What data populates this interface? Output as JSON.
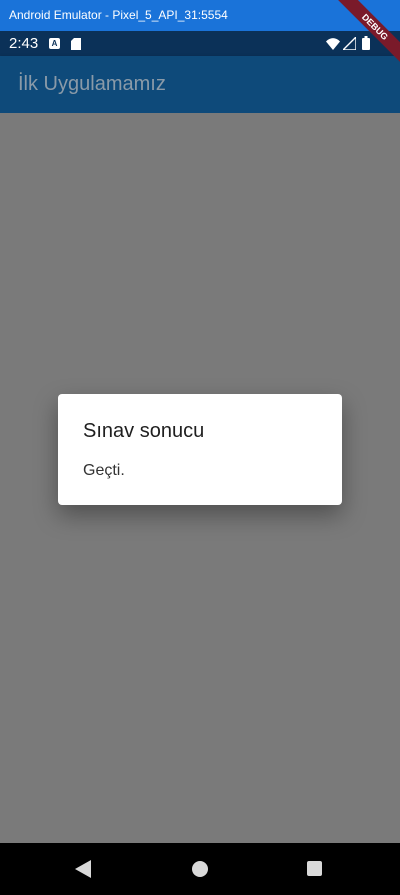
{
  "window": {
    "title": "Android Emulator - Pixel_5_API_31:5554"
  },
  "status_bar": {
    "time": "2:43",
    "notification_icon_letter": "A",
    "icons": [
      "notification-a-icon",
      "sd-card-icon",
      "wifi-icon",
      "signal-icon",
      "battery-icon"
    ]
  },
  "app_bar": {
    "title": "İlk Uygulamamız"
  },
  "debug_banner": {
    "label": "DEBUG"
  },
  "dialog": {
    "title": "Sınav sonucu",
    "content": "Geçti."
  },
  "nav_bar": {
    "icons": [
      "back-icon",
      "home-icon",
      "recents-icon"
    ]
  },
  "colors": {
    "window_titlebar": "#1a73d9",
    "status_bar": "#0b3158",
    "app_bar": "#0e4a7a",
    "scrim": "#7a7a7a",
    "debug_banner": "#7a1a2a"
  }
}
